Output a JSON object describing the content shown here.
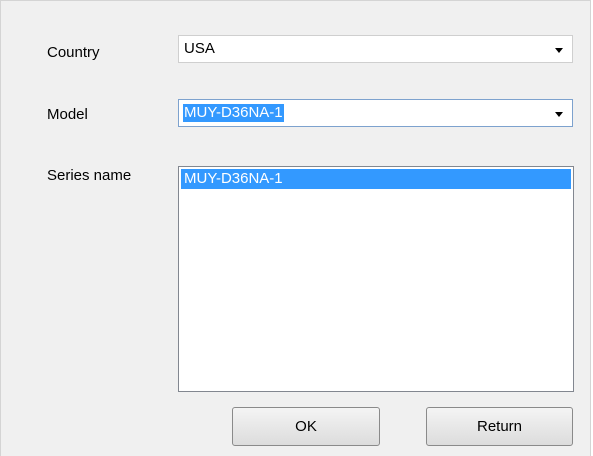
{
  "form": {
    "country_label": "Country",
    "country_value": "USA",
    "model_label": "Model",
    "model_value": "MUY-D36NA-1",
    "series_label": "Series name",
    "series_items": [
      "MUY-D36NA-1"
    ]
  },
  "buttons": {
    "ok_label": "OK",
    "return_label": "Return"
  },
  "icons": {
    "dropdown": "chevron-down-icon"
  },
  "colors": {
    "selection": "#3399ff",
    "dialog_bg": "#f0f0f0"
  }
}
